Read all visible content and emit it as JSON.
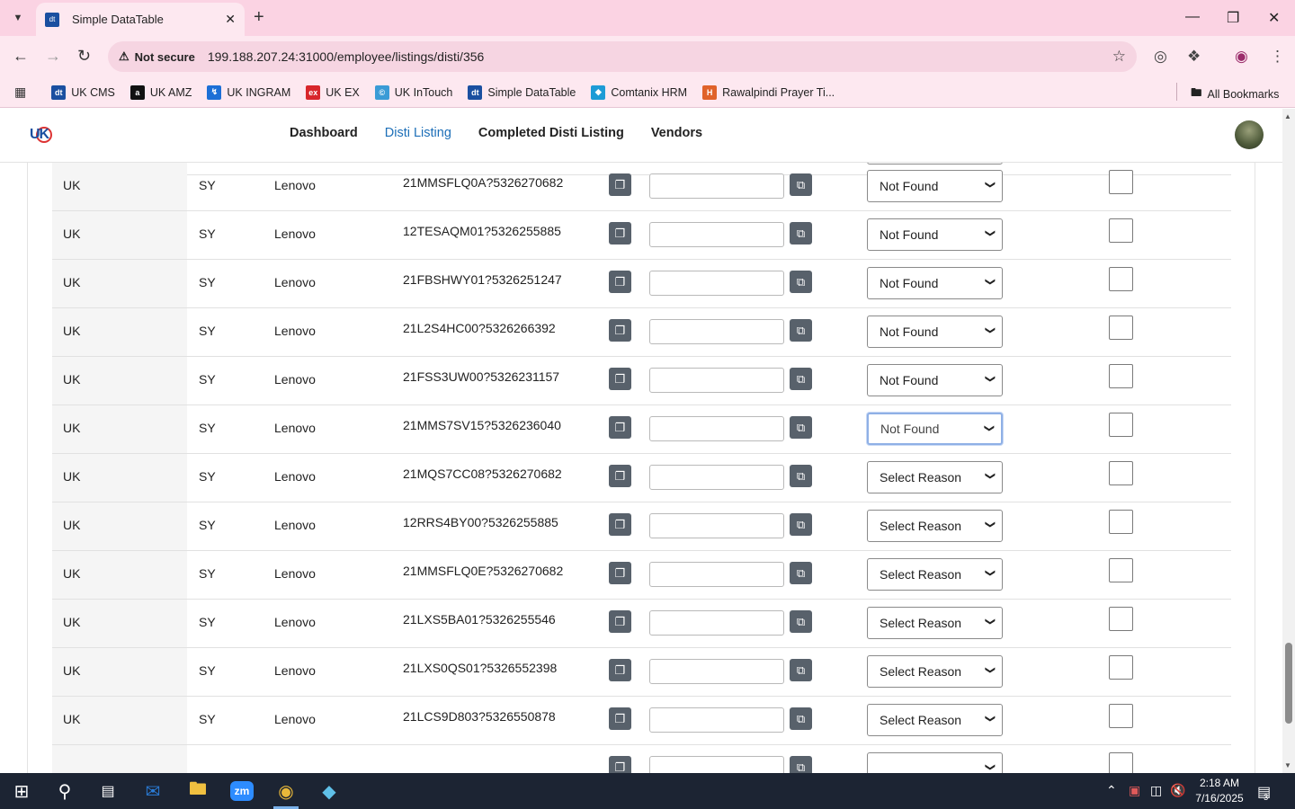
{
  "browser": {
    "tab_title": "Simple DataTable",
    "tab_favicon": "dt",
    "not_secure": "Not secure",
    "url": "199.188.207.24:31000/employee/listings/disti/356",
    "bookmarks": [
      {
        "label": "UK CMS",
        "icon": "dt",
        "color": "#1a4fa0"
      },
      {
        "label": "UK AMZ",
        "icon": "a",
        "color": "#111"
      },
      {
        "label": "UK INGRAM",
        "icon": "↯",
        "color": "#1c6fd6"
      },
      {
        "label": "UK EX",
        "icon": "ex",
        "color": "#d8262b"
      },
      {
        "label": "UK InTouch",
        "icon": "©",
        "color": "#3a9bd6"
      },
      {
        "label": "Simple DataTable",
        "icon": "dt",
        "color": "#1a4fa0"
      },
      {
        "label": "Comtanix HRM",
        "icon": "◆",
        "color": "#1d9bd6"
      },
      {
        "label": "Rawalpindi Prayer Ti...",
        "icon": "H",
        "color": "#e0622a"
      }
    ],
    "all_bookmarks": "All Bookmarks"
  },
  "nav": {
    "links": [
      "Dashboard",
      "Disti Listing",
      "Completed Disti Listing",
      "Vendors"
    ],
    "active": "Disti Listing"
  },
  "table": {
    "rows": [
      {
        "country": "UK",
        "code": "SY",
        "brand": "Lenovo",
        "mpn": "21MMSFLQ0A?5326270682",
        "reason": "Not Found"
      },
      {
        "country": "UK",
        "code": "SY",
        "brand": "Lenovo",
        "mpn": "12TESAQM01?5326255885",
        "reason": "Not Found"
      },
      {
        "country": "UK",
        "code": "SY",
        "brand": "Lenovo",
        "mpn": "21FBSHWY01?5326251247",
        "reason": "Not Found"
      },
      {
        "country": "UK",
        "code": "SY",
        "brand": "Lenovo",
        "mpn": "21L2S4HC00?5326266392",
        "reason": "Not Found"
      },
      {
        "country": "UK",
        "code": "SY",
        "brand": "Lenovo",
        "mpn": "21FSS3UW00?5326231157",
        "reason": "Not Found"
      },
      {
        "country": "UK",
        "code": "SY",
        "brand": "Lenovo",
        "mpn": "21MMS7SV15?5326236040",
        "reason": "Not Found",
        "focused": true
      },
      {
        "country": "UK",
        "code": "SY",
        "brand": "Lenovo",
        "mpn": "21MQS7CC08?5326270682",
        "reason": "Select Reason"
      },
      {
        "country": "UK",
        "code": "SY",
        "brand": "Lenovo",
        "mpn": "12RRS4BY00?5326255885",
        "reason": "Select Reason"
      },
      {
        "country": "UK",
        "code": "SY",
        "brand": "Lenovo",
        "mpn": "21MMSFLQ0E?5326270682",
        "reason": "Select Reason"
      },
      {
        "country": "UK",
        "code": "SY",
        "brand": "Lenovo",
        "mpn": "21LXS5BA01?5326255546",
        "reason": "Select Reason"
      },
      {
        "country": "UK",
        "code": "SY",
        "brand": "Lenovo",
        "mpn": "21LXS0QS01?5326552398",
        "reason": "Select Reason"
      },
      {
        "country": "UK",
        "code": "SY",
        "brand": "Lenovo",
        "mpn": "21LCS9D803?5326550878",
        "reason": "Select Reason"
      },
      {
        "country": "",
        "code": "",
        "brand": "",
        "mpn": "",
        "reason": ""
      }
    ]
  },
  "taskbar": {
    "time": "2:18 AM",
    "date": "7/16/2025",
    "notifications": "3"
  }
}
